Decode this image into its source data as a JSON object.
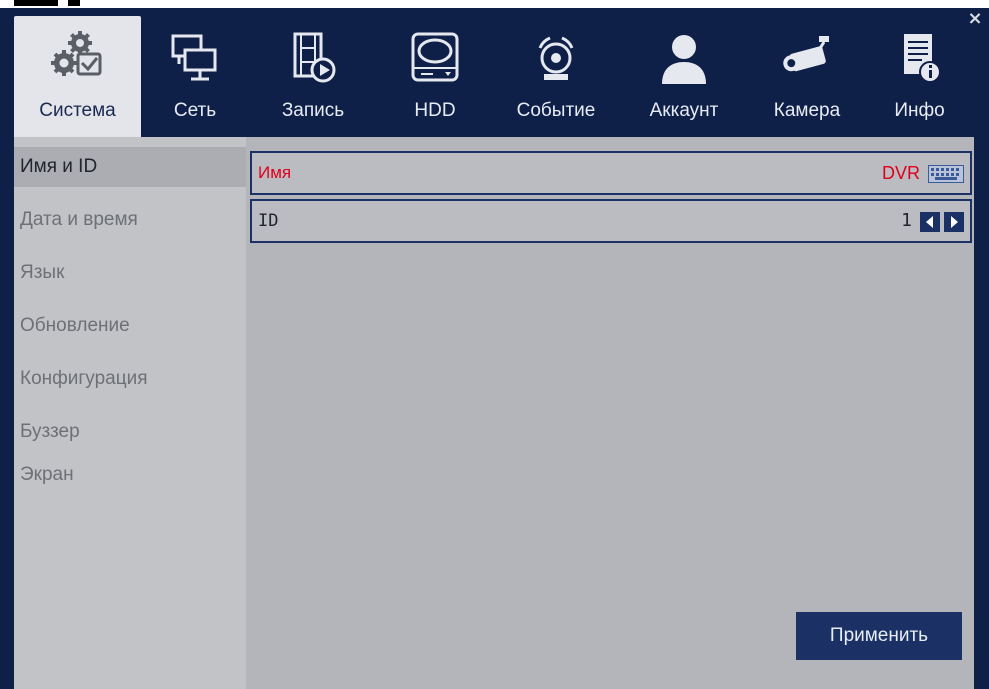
{
  "window": {
    "close_label": "×"
  },
  "tabs": [
    {
      "id": "system",
      "label": "Система",
      "icon": "settings-check-icon",
      "active": true
    },
    {
      "id": "network",
      "label": "Сеть",
      "icon": "network-monitors-icon",
      "active": false
    },
    {
      "id": "record",
      "label": "Запись",
      "icon": "record-film-icon",
      "active": false
    },
    {
      "id": "hdd",
      "label": "HDD",
      "icon": "hdd-icon",
      "active": false
    },
    {
      "id": "event",
      "label": "Событие",
      "icon": "alarm-event-icon",
      "active": false
    },
    {
      "id": "account",
      "label": "Аккаунт",
      "icon": "user-account-icon",
      "active": false
    },
    {
      "id": "camera",
      "label": "Камера",
      "icon": "camera-icon",
      "active": false
    },
    {
      "id": "info",
      "label": "Инфо",
      "icon": "document-info-icon",
      "active": false
    }
  ],
  "sidebar": {
    "items": [
      {
        "label": "Имя и ID",
        "selected": true
      },
      {
        "label": "Дата и время",
        "selected": false
      },
      {
        "label": "Язык",
        "selected": false
      },
      {
        "label": "Обновление",
        "selected": false
      },
      {
        "label": "Конфигурация",
        "selected": false
      },
      {
        "label": "Буззер",
        "selected": false
      },
      {
        "label": "Экран",
        "selected": false
      }
    ]
  },
  "fields": {
    "name": {
      "label": "Имя",
      "value": "DVR",
      "icon": "keyboard-icon"
    },
    "id": {
      "label": "ID",
      "value": "1",
      "icon_left": "arrow-left-icon",
      "icon_right": "arrow-right-icon"
    }
  },
  "actions": {
    "apply_label": "Применить"
  },
  "colors": {
    "frame": "#0e1f48",
    "accent": "#1b3065",
    "active_tab": "#e3e5ea",
    "content_bg": "#b4b5ba",
    "sidebar_bg": "#c2c3c7",
    "name_text": "#e0001b"
  }
}
